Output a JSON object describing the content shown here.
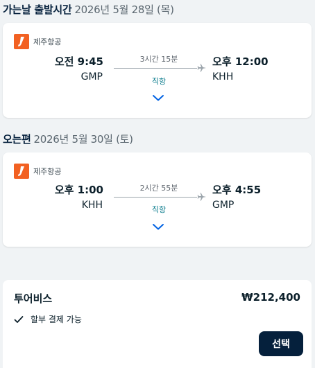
{
  "outbound": {
    "heading": "가는날 출발시간",
    "date": "2026년 5월 28일 (목)",
    "airline": "제주항공",
    "dep_time": "오전 9:45",
    "dep_code": "GMP",
    "duration": "3시간 15분",
    "stops": "직항",
    "arr_time": "오후 12:00",
    "arr_code": "KHH"
  },
  "inbound": {
    "heading": "오는편",
    "date": "2026년 5월 30일 (토)",
    "airline": "제주항공",
    "dep_time": "오후 1:00",
    "dep_code": "KHH",
    "duration": "2시간 55분",
    "stops": "직항",
    "arr_time": "오후 4:55",
    "arr_code": "GMP"
  },
  "offer": {
    "agent": "투어비스",
    "price": "₩212,400",
    "feature": "할부 결제 가능",
    "select_label": "선택"
  },
  "colors": {
    "airline_logo": "#f26122",
    "accent_teal": "#0a7b8c",
    "chevron": "#0062e3",
    "button_bg": "#05203c"
  },
  "icons": [
    "airline-logo-icon",
    "plane-icon",
    "chevron-down-icon",
    "checkmark-icon"
  ]
}
